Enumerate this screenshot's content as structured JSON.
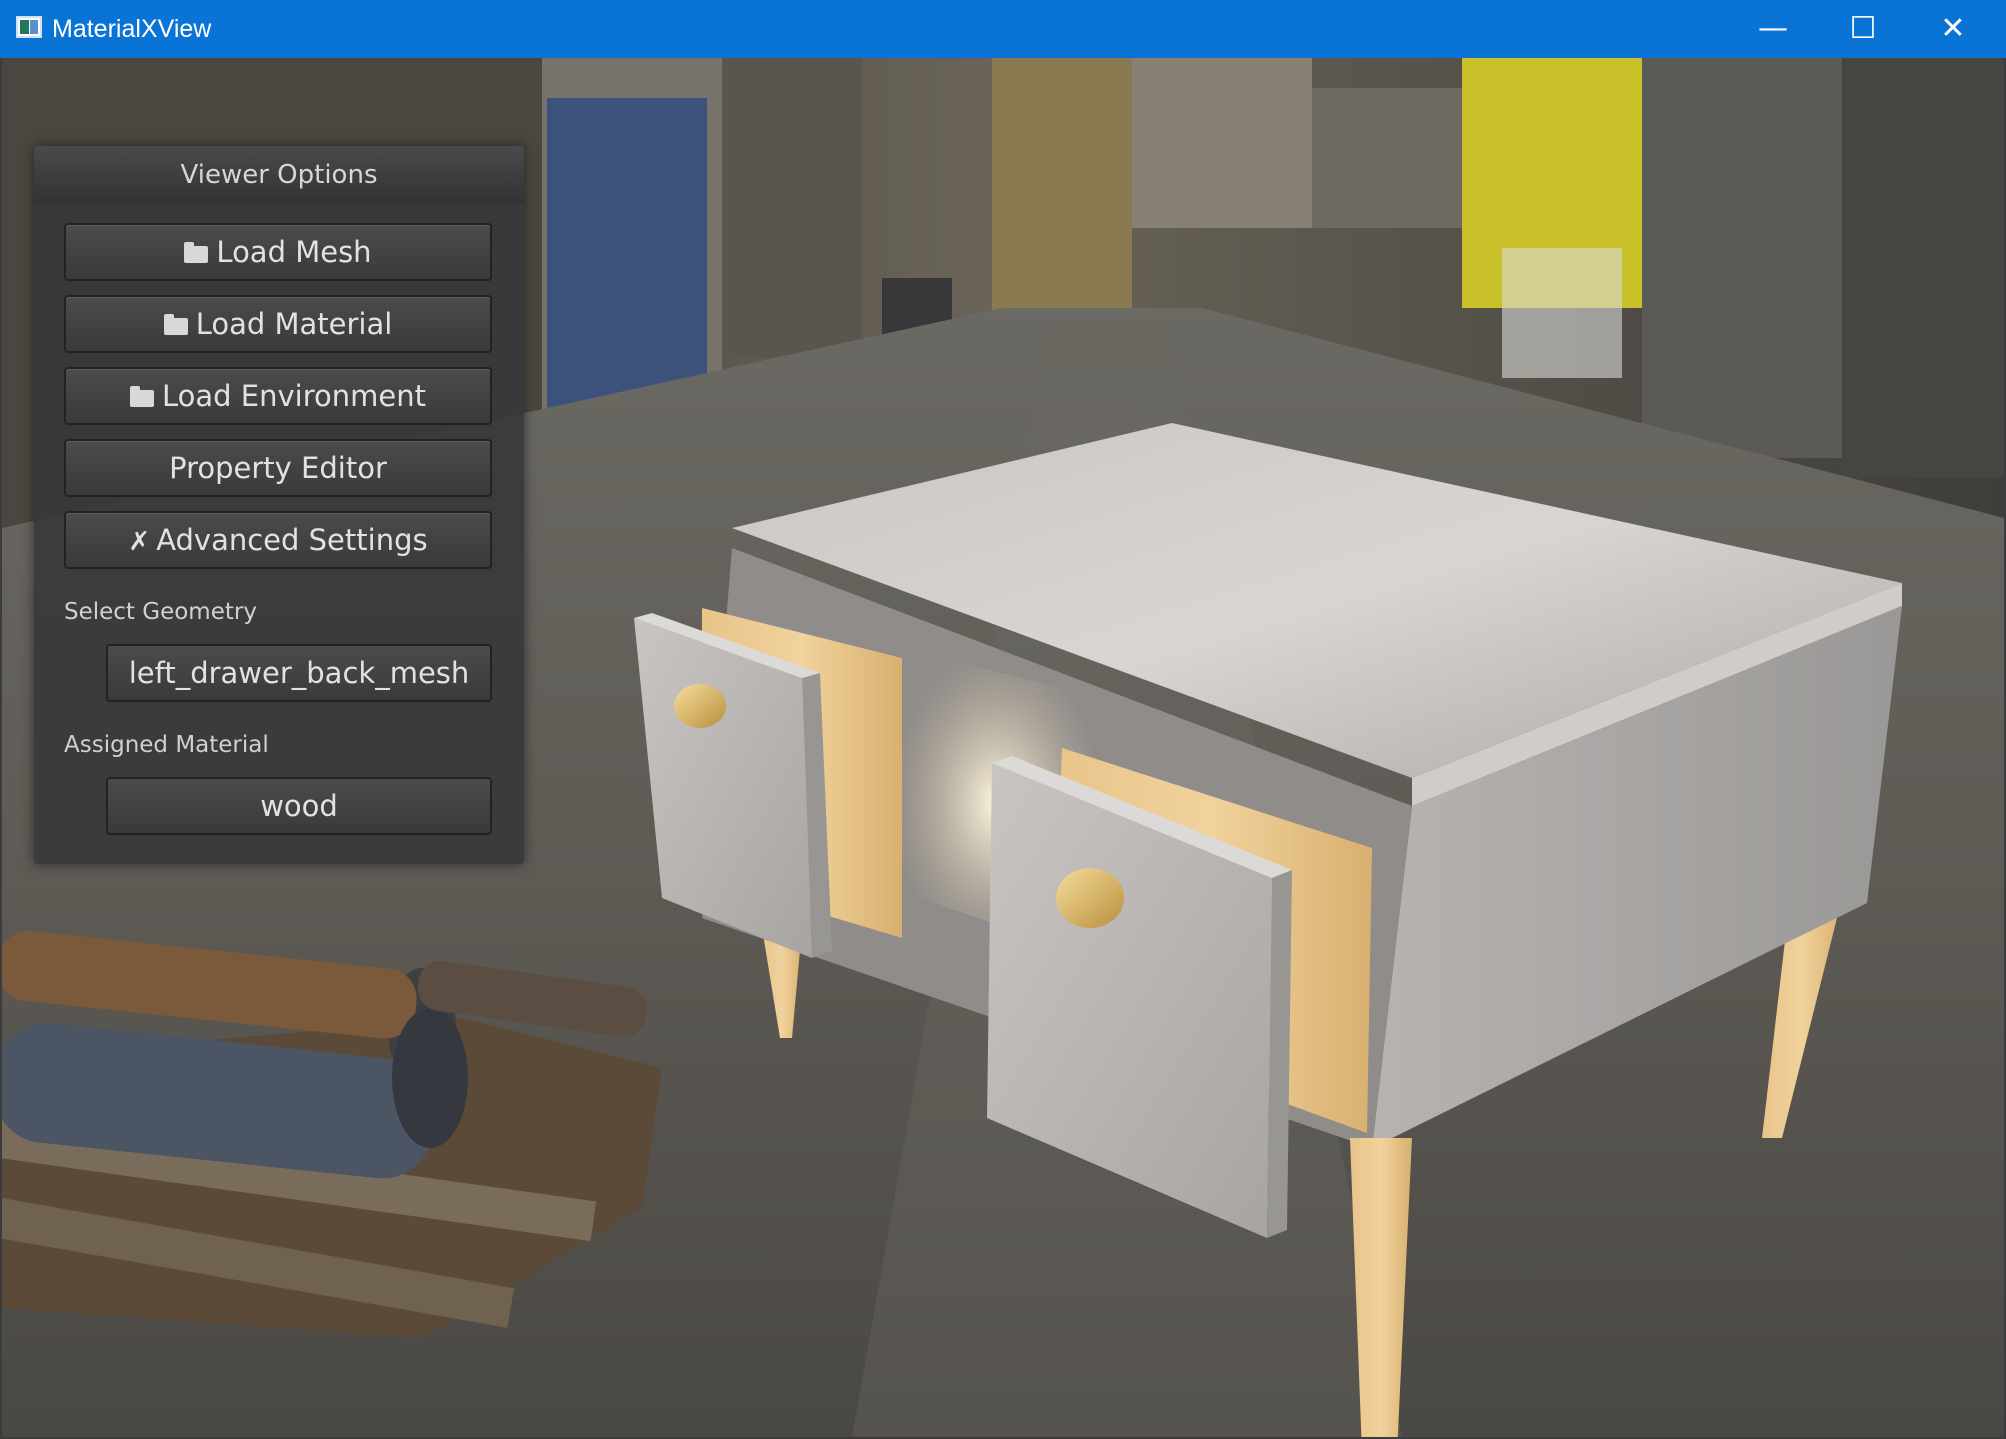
{
  "window": {
    "title": "MaterialXView",
    "minimize_icon": "minimize-icon",
    "maximize_icon": "maximize-icon",
    "close_icon": "close-icon",
    "titlebar_color": "#0a74d6"
  },
  "panel": {
    "title": "Viewer Options",
    "buttons": {
      "load_mesh": "Load Mesh",
      "load_material": "Load Material",
      "load_environment": "Load Environment",
      "property_editor": "Property Editor",
      "advanced_settings": "Advanced Settings"
    },
    "icons": {
      "folder": "folder-icon",
      "tools": "tools-icon"
    },
    "select_geometry": {
      "label": "Select Geometry",
      "value": "left_drawer_back_mesh"
    },
    "assigned_material": {
      "label": "Assigned Material",
      "value": "wood"
    }
  },
  "viewport": {
    "scene": "3D preview of a metal cabinet with wooden drawers and legs in an industrial environment"
  }
}
